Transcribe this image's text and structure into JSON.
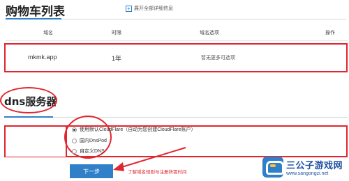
{
  "cart": {
    "title": "购物车列表",
    "expand_label": "展开全部详细信息",
    "columns": [
      "域名",
      "时限",
      "域名选项",
      "操作"
    ],
    "rows": [
      {
        "domain": "mkmk.app",
        "period": "1年",
        "options": "暂无更多可选项"
      }
    ]
  },
  "dns": {
    "title": "dns服务器",
    "options": [
      {
        "label": "使用默认CloudFlare（自动为您创建CloudFlare账户）",
        "selected": true
      },
      {
        "label": "国内DnsPod",
        "selected": false
      },
      {
        "label": "自定义DNS",
        "selected": false
      }
    ]
  },
  "actions": {
    "next_label": "下一步",
    "annotation": "了解域名规则与注册所需时间"
  },
  "watermark": {
    "name": "三公子游戏网",
    "url": "www.sangongzi.net"
  },
  "colors": {
    "accent": "#2f80c8",
    "annotation_red": "#e0262e"
  }
}
